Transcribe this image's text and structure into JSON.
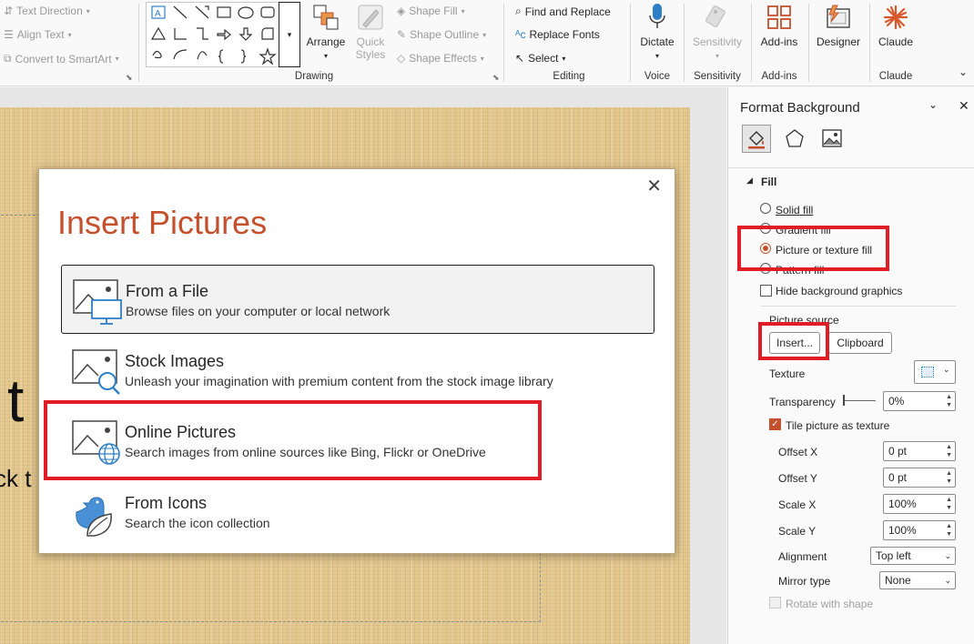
{
  "ribbon": {
    "paragraph": {
      "text_direction": "Text Direction",
      "align_text": "Align Text",
      "convert_smartart": "Convert to SmartArt"
    },
    "drawing": {
      "arrange": "Arrange",
      "quick_styles": "Quick Styles",
      "shape_fill": "Shape Fill",
      "shape_outline": "Shape Outline",
      "shape_effects": "Shape Effects",
      "label": "Drawing"
    },
    "editing": {
      "find_replace": "Find and Replace",
      "replace_fonts": "Replace Fonts",
      "select": "Select",
      "label": "Editing"
    },
    "voice": {
      "dictate": "Dictate",
      "label": "Voice"
    },
    "sensitivity": {
      "button": "Sensitivity",
      "label": "Sensitivity"
    },
    "addins": {
      "button": "Add-ins",
      "label": "Add-ins"
    },
    "designer": {
      "button": "Designer"
    },
    "claude": {
      "button": "Claude",
      "label": "Claude"
    }
  },
  "slide": {
    "title_fragment": "t",
    "subtitle_fragment": "ck t"
  },
  "dialog": {
    "title": "Insert Pictures",
    "options": [
      {
        "title": "From a File",
        "description": "Browse files on your computer or local network"
      },
      {
        "title": "Stock Images",
        "description": "Unleash your imagination with premium content from the stock image library"
      },
      {
        "title": "Online Pictures",
        "description": "Search images from online sources like Bing, Flickr or OneDrive"
      },
      {
        "title": "From Icons",
        "description": "Search the icon collection"
      }
    ]
  },
  "pane": {
    "title": "Format Background",
    "fill_header": "Fill",
    "solid_fill": "Solid fill",
    "gradient_fill": "Gradient fill",
    "picture_texture_fill": "Picture or texture fill",
    "pattern_fill": "Pattern fill",
    "hide_bg_graphics": "Hide background graphics",
    "picture_source": "Picture source",
    "insert_button": "Insert...",
    "clipboard_button": "Clipboard",
    "texture": "Texture",
    "transparency": "Transparency",
    "transparency_value": "0%",
    "tile_picture": "Tile picture as texture",
    "offset_x": "Offset X",
    "offset_x_value": "0 pt",
    "offset_y": "Offset Y",
    "offset_y_value": "0 pt",
    "scale_x": "Scale X",
    "scale_x_value": "100%",
    "scale_y": "Scale Y",
    "scale_y_value": "100%",
    "alignment": "Alignment",
    "alignment_value": "Top left",
    "mirror_type": "Mirror type",
    "mirror_value": "None",
    "rotate_with_shape": "Rotate with shape"
  },
  "colors": {
    "accent": "#c4502d",
    "highlight": "#e01c24",
    "icon_blue": "#2f7fc6"
  }
}
